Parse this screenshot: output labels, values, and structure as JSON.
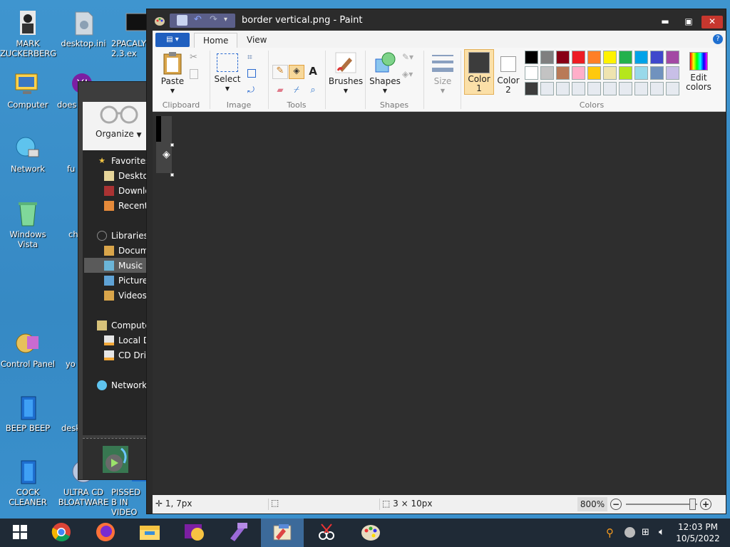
{
  "desktop": {
    "icons": [
      {
        "label": "MARK ZUCKERBERG",
        "icon": "person-icon"
      },
      {
        "label": "desktop.ini",
        "icon": "settings-file-icon"
      },
      {
        "label": "2PACALY 2.3.ex",
        "icon": "exe-icon"
      },
      {
        "label": "Computer",
        "icon": "computer-icon"
      },
      {
        "label": "does",
        "icon": "yahoo-icon"
      },
      {
        "label": "Network",
        "icon": "network-icon"
      },
      {
        "label": "fu",
        "icon": "file-icon"
      },
      {
        "label": "Windows Vista",
        "icon": "recycle-bin-icon"
      },
      {
        "label": "ch",
        "icon": "chrome-icon"
      },
      {
        "label": "Control Panel",
        "icon": "control-panel-icon"
      },
      {
        "label": "yo",
        "icon": "yahoo-icon"
      },
      {
        "label": "BEEP BEEP",
        "icon": "media-icon"
      },
      {
        "label": "desk",
        "icon": "file-icon"
      },
      {
        "label": "COCK CLEANER",
        "icon": "media-icon"
      },
      {
        "label": "ULTRA CD BLOATWARE",
        "icon": "cd-icon"
      },
      {
        "label": "PISSED B IN VIDEO",
        "icon": "video-icon"
      }
    ]
  },
  "explorer": {
    "organize_label": "Organize",
    "nav": [
      {
        "label": "Favorites",
        "icon": "star-icon"
      },
      {
        "label": "Desktop",
        "icon": "desktop-icon"
      },
      {
        "label": "Downlo",
        "icon": "download-icon"
      },
      {
        "label": "Recent",
        "icon": "recent-icon"
      },
      {
        "label": "Libraries",
        "icon": "library-icon"
      },
      {
        "label": "Docum",
        "icon": "documents-icon"
      },
      {
        "label": "Music",
        "icon": "music-icon"
      },
      {
        "label": "Picture",
        "icon": "pictures-icon"
      },
      {
        "label": "Videos",
        "icon": "videos-icon"
      },
      {
        "label": "Compute",
        "icon": "computer-icon"
      },
      {
        "label": "Local D",
        "icon": "drive-icon"
      },
      {
        "label": "CD Driv",
        "icon": "cd-drive-icon"
      },
      {
        "label": "Network",
        "icon": "network-icon"
      }
    ]
  },
  "paint": {
    "title": "border vertical.png - Paint",
    "tabs": {
      "menu": "",
      "home": "Home",
      "view": "View"
    },
    "ribbon": {
      "paste": "Paste",
      "select": "Select",
      "brushes": "Brushes",
      "shapes": "Shapes",
      "size": "Size",
      "color1": "Color\n1",
      "color1_line1": "Color",
      "color1_line2": "1",
      "color2_line1": "Color",
      "color2_line2": "2",
      "edit_colors_line1": "Edit",
      "edit_colors_line2": "colors",
      "groups": {
        "clipboard": "Clipboard",
        "image": "Image",
        "tools": "Tools",
        "shapes": "Shapes",
        "colors": "Colors"
      }
    },
    "colors": {
      "color1": "#3c3c3c",
      "color2": "#ffffff",
      "palette_row1": [
        "#000000",
        "#7f7f7f",
        "#880015",
        "#ed1c24",
        "#ff7f27",
        "#fff200",
        "#22b14c",
        "#00a2e8",
        "#3f48cc",
        "#a349a4"
      ],
      "palette_row2": [
        "#ffffff",
        "#c3c3c3",
        "#b97a57",
        "#ffaec9",
        "#ffc90e",
        "#efe4b0",
        "#b5e61d",
        "#99d9ea",
        "#7092be",
        "#c8bfe7"
      ],
      "palette_row3": [
        "#3c3c3c",
        "#e6eaf0",
        "#e6eaf0",
        "#e6eaf0",
        "#e6eaf0",
        "#e6eaf0",
        "#e6eaf0",
        "#e6eaf0",
        "#e6eaf0",
        "#e6eaf0"
      ]
    },
    "status": {
      "position": "1, 7px",
      "selection": "",
      "size": "3 × 10px",
      "zoom": "800%",
      "zoom_fraction": 0.93
    }
  },
  "taskbar": {
    "time": "12:03 PM",
    "date": "10/5/2022",
    "apps": [
      "windows-start-icon",
      "chrome-icon",
      "firefox-icon",
      "file-explorer-icon",
      "yahoo-messenger-icon",
      "visual-studio-icon",
      "paint-icon",
      "snipping-tool-icon",
      "paint-palette-icon"
    ]
  }
}
